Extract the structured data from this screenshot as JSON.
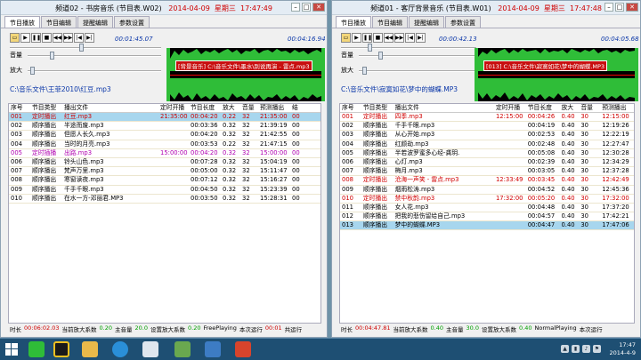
{
  "win1": {
    "title_prefix": "频道02 - 书房音乐 (节目表.W02)",
    "date": "2014-04-09",
    "weekday": "星期三",
    "time": "17:47:49",
    "tabs": [
      "节目播放",
      "节目编辑",
      "提醒编辑",
      "参数设置"
    ],
    "elapsed": "00:01:45.07",
    "remaining": "00:04:16.94",
    "volume_label": "音量",
    "gain_label": "放大",
    "file_path": "C:\\音乐文件\\王菲2010\\红豆.mp3",
    "wave_label": "[背景音乐] C:\\音乐文件\\墨水\\别说再演 - 雷点.mp3",
    "columns": [
      "序号",
      "节目类型",
      "播出文件",
      "定时开播",
      "节目长度",
      "放大",
      "音量",
      "预测播出",
      "结"
    ],
    "rows": [
      {
        "no": "001",
        "type": "定时播出",
        "file": "红豆.mp3",
        "sched": "21:35:00",
        "len": "00:04:20",
        "amp": "0.22",
        "vol": "32",
        "pred": "21:35:00",
        "end": "00",
        "style": "red",
        "sel": true
      },
      {
        "no": "002",
        "type": "顺序播出",
        "file": "半途而废.mp3",
        "sched": "",
        "len": "00:03:36",
        "amp": "0.32",
        "vol": "32",
        "pred": "21:39:19",
        "end": "00",
        "style": "",
        "sel": false
      },
      {
        "no": "003",
        "type": "顺序播出",
        "file": "但愿人长久.mp3",
        "sched": "",
        "len": "00:04:20",
        "amp": "0.32",
        "vol": "32",
        "pred": "21:42:55",
        "end": "00",
        "style": "",
        "sel": false
      },
      {
        "no": "004",
        "type": "顺序播出",
        "file": "当时的月亮.mp3",
        "sched": "",
        "len": "00:03:53",
        "amp": "0.22",
        "vol": "32",
        "pred": "21:47:15",
        "end": "00",
        "style": "",
        "sel": false
      },
      {
        "no": "005",
        "type": "定时插播",
        "file": "出路.mp3",
        "sched": "15:00:00",
        "len": "00:04:20",
        "amp": "0.32",
        "vol": "32",
        "pred": "15:00:00",
        "end": "00",
        "style": "magenta",
        "sel": false
      },
      {
        "no": "006",
        "type": "顺序播出",
        "file": "铃头山色.mp3",
        "sched": "",
        "len": "00:07:28",
        "amp": "0.32",
        "vol": "32",
        "pred": "15:04:19",
        "end": "00",
        "style": "",
        "sel": false
      },
      {
        "no": "007",
        "type": "顺序播出",
        "file": "梵声万里.mp3",
        "sched": "",
        "len": "00:05:00",
        "amp": "0.32",
        "vol": "32",
        "pred": "15:11:47",
        "end": "00",
        "style": "",
        "sel": false
      },
      {
        "no": "008",
        "type": "顺序播出",
        "file": "寒窗读夜.mp3",
        "sched": "",
        "len": "00:07:12",
        "amp": "0.32",
        "vol": "32",
        "pred": "15:16:27",
        "end": "00",
        "style": "",
        "sel": false
      },
      {
        "no": "009",
        "type": "顺序播出",
        "file": "千手千眼.mp3",
        "sched": "",
        "len": "00:04:50",
        "amp": "0.32",
        "vol": "32",
        "pred": "15:23:39",
        "end": "00",
        "style": "",
        "sel": false
      },
      {
        "no": "010",
        "type": "顺序播出",
        "file": "在水一方-邓丽君.MP3",
        "sched": "",
        "len": "00:03:50",
        "amp": "0.32",
        "vol": "32",
        "pred": "15:28:31",
        "end": "00",
        "style": "",
        "sel": false
      }
    ],
    "status": {
      "dur_label": "时长",
      "dur": "00:06:02.03",
      "cur_label": "当前放大系数",
      "cur": "0.20",
      "vol_label": "主音量",
      "vol": "20.0",
      "set_label": "设置放大系数",
      "set": "0.20",
      "mode": "FreePlaying",
      "run_label": "本次运行",
      "run": "00:01",
      "tail": "共运行"
    }
  },
  "win2": {
    "title_prefix": "频道01 - 客厅背景音乐 (节目表.W01)",
    "date": "2014-04-09",
    "weekday": "星期三",
    "time": "17:47:48",
    "tabs": [
      "节目播放",
      "节目编辑",
      "提醒编辑",
      "参数设置"
    ],
    "elapsed": "00:00:42.13",
    "remaining": "00:04:05.68",
    "volume_label": "音量",
    "gain_label": "放大",
    "file_path": "C:\\音乐文件\\寂寞如花\\梦中的蝴蝶.MP3",
    "wave_label": "[013] C:\\音乐文件\\寂寞如花\\梦中的蝴蝶.MP3",
    "columns": [
      "序号",
      "节目类型",
      "播出文件",
      "定时开播",
      "节目长度",
      "放大",
      "音量",
      "预测播出"
    ],
    "rows": [
      {
        "no": "001",
        "type": "定时播出",
        "file": "四季.mp3",
        "sched": "12:15:00",
        "len": "00:04:26",
        "amp": "0.40",
        "vol": "30",
        "pred": "12:15:00",
        "style": "red",
        "sel": false
      },
      {
        "no": "002",
        "type": "顺序播出",
        "file": "千手千眼.mp3",
        "sched": "",
        "len": "00:04:19",
        "amp": "0.40",
        "vol": "30",
        "pred": "12:19:26",
        "style": "",
        "sel": false
      },
      {
        "no": "003",
        "type": "顺序播出",
        "file": "从心开始.mp3",
        "sched": "",
        "len": "00:02:53",
        "amp": "0.40",
        "vol": "30",
        "pred": "12:22:19",
        "style": "",
        "sel": false
      },
      {
        "no": "004",
        "type": "顺序播出",
        "file": "红颜劫.mp3",
        "sched": "",
        "len": "00:02:48",
        "amp": "0.40",
        "vol": "30",
        "pred": "12:27:47",
        "style": "",
        "sel": false
      },
      {
        "no": "005",
        "type": "顺序播出",
        "file": "半若波罗蜜多心经-龚玥.",
        "sched": "",
        "len": "00:05:08",
        "amp": "0.40",
        "vol": "30",
        "pred": "12:30:28",
        "style": "",
        "sel": false
      },
      {
        "no": "006",
        "type": "顺序播出",
        "file": "心灯.mp3",
        "sched": "",
        "len": "00:02:39",
        "amp": "0.40",
        "vol": "30",
        "pred": "12:34:29",
        "style": "",
        "sel": false
      },
      {
        "no": "007",
        "type": "顺序播出",
        "file": "梅月.mp3",
        "sched": "",
        "len": "00:03:05",
        "amp": "0.40",
        "vol": "30",
        "pred": "12:37:28",
        "style": "",
        "sel": false
      },
      {
        "no": "008",
        "type": "定时播出",
        "file": "沧海一声笑 - 雷点.mp3",
        "sched": "12:33:49",
        "len": "00:03:45",
        "amp": "0.40",
        "vol": "30",
        "pred": "12:42:49",
        "style": "red",
        "sel": false
      },
      {
        "no": "009",
        "type": "顺序播出",
        "file": "烟雨松涛.mp3",
        "sched": "",
        "len": "00:04:52",
        "amp": "0.40",
        "vol": "30",
        "pred": "12:45:36",
        "style": "",
        "sel": false
      },
      {
        "no": "010",
        "type": "定时播出",
        "file": "禁中秋韵.mp3",
        "sched": "17:32:00",
        "len": "00:05:20",
        "amp": "0.40",
        "vol": "30",
        "pred": "17:32:00",
        "style": "red",
        "sel": false
      },
      {
        "no": "011",
        "type": "顺序播出",
        "file": "女人花.mp3",
        "sched": "",
        "len": "00:04:48",
        "amp": "0.40",
        "vol": "30",
        "pred": "17:37:20",
        "style": "",
        "sel": false
      },
      {
        "no": "012",
        "type": "顺序播出",
        "file": "把我的悲伤留给自己.mp3",
        "sched": "",
        "len": "00:04:57",
        "amp": "0.40",
        "vol": "30",
        "pred": "17:42:21",
        "style": "",
        "sel": false
      },
      {
        "no": "013",
        "type": "顺序播出",
        "file": "梦中的蝴蝶.MP3",
        "sched": "",
        "len": "00:04:47",
        "amp": "0.40",
        "vol": "30",
        "pred": "17:47:06",
        "style": "",
        "sel": true
      }
    ],
    "status": {
      "dur_label": "时长",
      "dur": "00:04:47.81",
      "cur_label": "当前放大系数",
      "cur": "0.40",
      "vol_label": "主音量",
      "vol": "30.0",
      "set_label": "设置放大系数",
      "set": "0.40",
      "mode": "NormalPlaying",
      "run_label": "本次运行",
      "run": "",
      "tail": ""
    }
  },
  "taskbar": {
    "time": "17:47",
    "date": "2014-4-9"
  },
  "colors": {
    "accent_red": "#d00000",
    "time_blue": "#0a36a8",
    "selected_row": "#a7d6ee",
    "wave_green": "#2fbd38"
  }
}
